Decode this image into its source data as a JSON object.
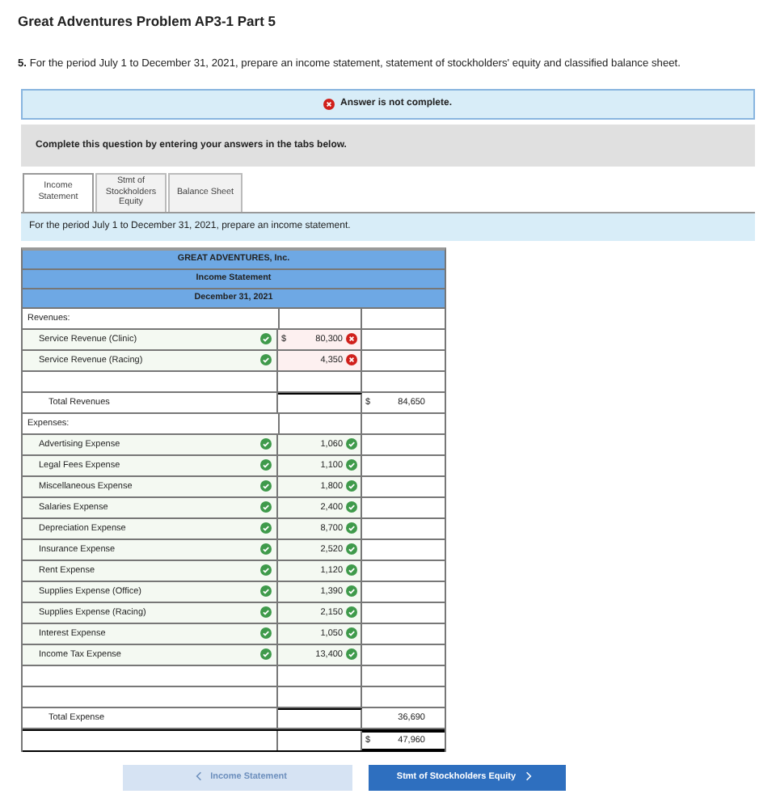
{
  "title": "Great Adventures Problem AP3-1 Part 5",
  "question": {
    "number": "5.",
    "text": "For the period July 1 to December 31, 2021, prepare an income statement, statement of stockholders' equity and classified balance sheet."
  },
  "alert": {
    "text": "Answer is not complete."
  },
  "instructions": "Complete this question by entering your answers in the tabs below.",
  "tabs": [
    {
      "label": "Income Statement",
      "selected": true
    },
    {
      "label": "Stmt of Stockholders Equity",
      "selected": false
    },
    {
      "label": "Balance Sheet",
      "selected": false
    }
  ],
  "prompt": "For the period July 1 to December 31, 2021, prepare an income statement.",
  "statement": {
    "headers": [
      "GREAT ADVENTURES, Inc.",
      "Income Statement",
      "December 31, 2021"
    ],
    "rows": [
      {
        "kind": "heading",
        "label": "Revenues:"
      },
      {
        "kind": "item",
        "label": "Service Revenue (Clinic)",
        "correct": true,
        "dollar": "$",
        "amount": "80,300",
        "amount_correct": false
      },
      {
        "kind": "item",
        "label": "Service Revenue (Racing)",
        "correct": true,
        "amount": "4,350",
        "amount_correct": false
      },
      {
        "kind": "blank"
      },
      {
        "kind": "total",
        "label": "Total Revenues",
        "dollar": "$",
        "total": "84,650"
      },
      {
        "kind": "heading",
        "label": "Expenses:"
      },
      {
        "kind": "item",
        "label": "Advertising Expense",
        "correct": true,
        "amount": "1,060",
        "amount_correct": true
      },
      {
        "kind": "item",
        "label": "Legal Fees Expense",
        "correct": true,
        "amount": "1,100",
        "amount_correct": true
      },
      {
        "kind": "item",
        "label": "Miscellaneous Expense",
        "correct": true,
        "amount": "1,800",
        "amount_correct": true
      },
      {
        "kind": "item",
        "label": "Salaries Expense",
        "correct": true,
        "amount": "2,400",
        "amount_correct": true
      },
      {
        "kind": "item",
        "label": "Depreciation Expense",
        "correct": true,
        "amount": "8,700",
        "amount_correct": true
      },
      {
        "kind": "item",
        "label": "Insurance Expense",
        "correct": true,
        "amount": "2,520",
        "amount_correct": true
      },
      {
        "kind": "item",
        "label": "Rent Expense",
        "correct": true,
        "amount": "1,120",
        "amount_correct": true
      },
      {
        "kind": "item",
        "label": "Supplies Expense (Office)",
        "correct": true,
        "amount": "1,390",
        "amount_correct": true
      },
      {
        "kind": "item",
        "label": "Supplies Expense (Racing)",
        "correct": true,
        "amount": "2,150",
        "amount_correct": true
      },
      {
        "kind": "item",
        "label": "Interest Expense",
        "correct": true,
        "amount": "1,050",
        "amount_correct": true
      },
      {
        "kind": "item",
        "label": "Income Tax Expense",
        "correct": true,
        "amount": "13,400",
        "amount_correct": true
      },
      {
        "kind": "blank"
      },
      {
        "kind": "blank"
      },
      {
        "kind": "total",
        "label": "Total Expense",
        "total": "36,690"
      },
      {
        "kind": "net",
        "dollar": "$",
        "total": "47,960"
      }
    ]
  },
  "nav": {
    "previous": {
      "label": "Income Statement",
      "disabled": true
    },
    "next": {
      "label": "Stmt of Stockholders Equity",
      "disabled": false
    }
  }
}
